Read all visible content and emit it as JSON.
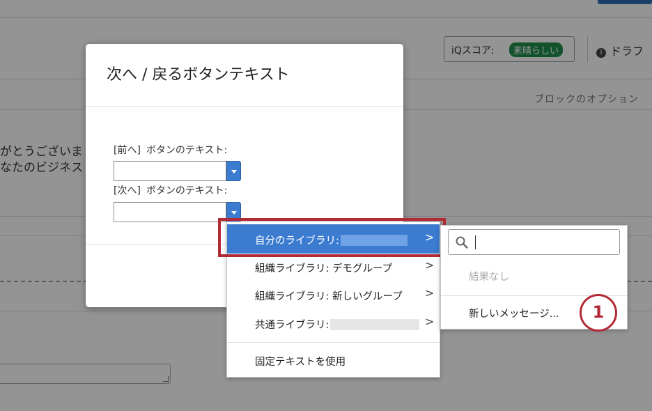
{
  "background": {
    "iq_score_label": "iQスコア:",
    "iq_score_badge": "素晴らしい",
    "draft_label": "ドラフ",
    "block_options": "ブロックのオプション",
    "question_text_line1": "がとうございま",
    "question_text_line2": "なたのビジネス",
    "colors": {
      "primary_blue": "#2f6fb6",
      "badge_green": "#1f8f4e"
    }
  },
  "modal": {
    "title": "次へ / 戻るボタンテキスト",
    "prev_field": {
      "bracket": "[前へ]",
      "label": "ボタンのテキスト:",
      "value": ""
    },
    "next_field": {
      "bracket": "[次へ]",
      "label": "ボタンのテキスト:",
      "value": ""
    }
  },
  "menu": {
    "items": [
      {
        "label": "自分のライブラリ:",
        "has_submenu": true,
        "active": true
      },
      {
        "label": "組織ライブラリ: デモグループ",
        "has_submenu": true,
        "active": false
      },
      {
        "label": "組織ライブラリ: 新しいグループ",
        "has_submenu": true,
        "active": false
      },
      {
        "label": "共通ライブラリ:",
        "has_submenu": true,
        "active": false
      },
      {
        "label": "固定テキストを使用",
        "has_submenu": false,
        "active": false
      }
    ],
    "chevron": ">",
    "highlight_color": "#b22a35",
    "active_color": "#3b7bd0"
  },
  "submenu": {
    "search_value": "",
    "no_results": "結果なし",
    "new_message": "新しいメッセージ..."
  },
  "step_badge": "1"
}
